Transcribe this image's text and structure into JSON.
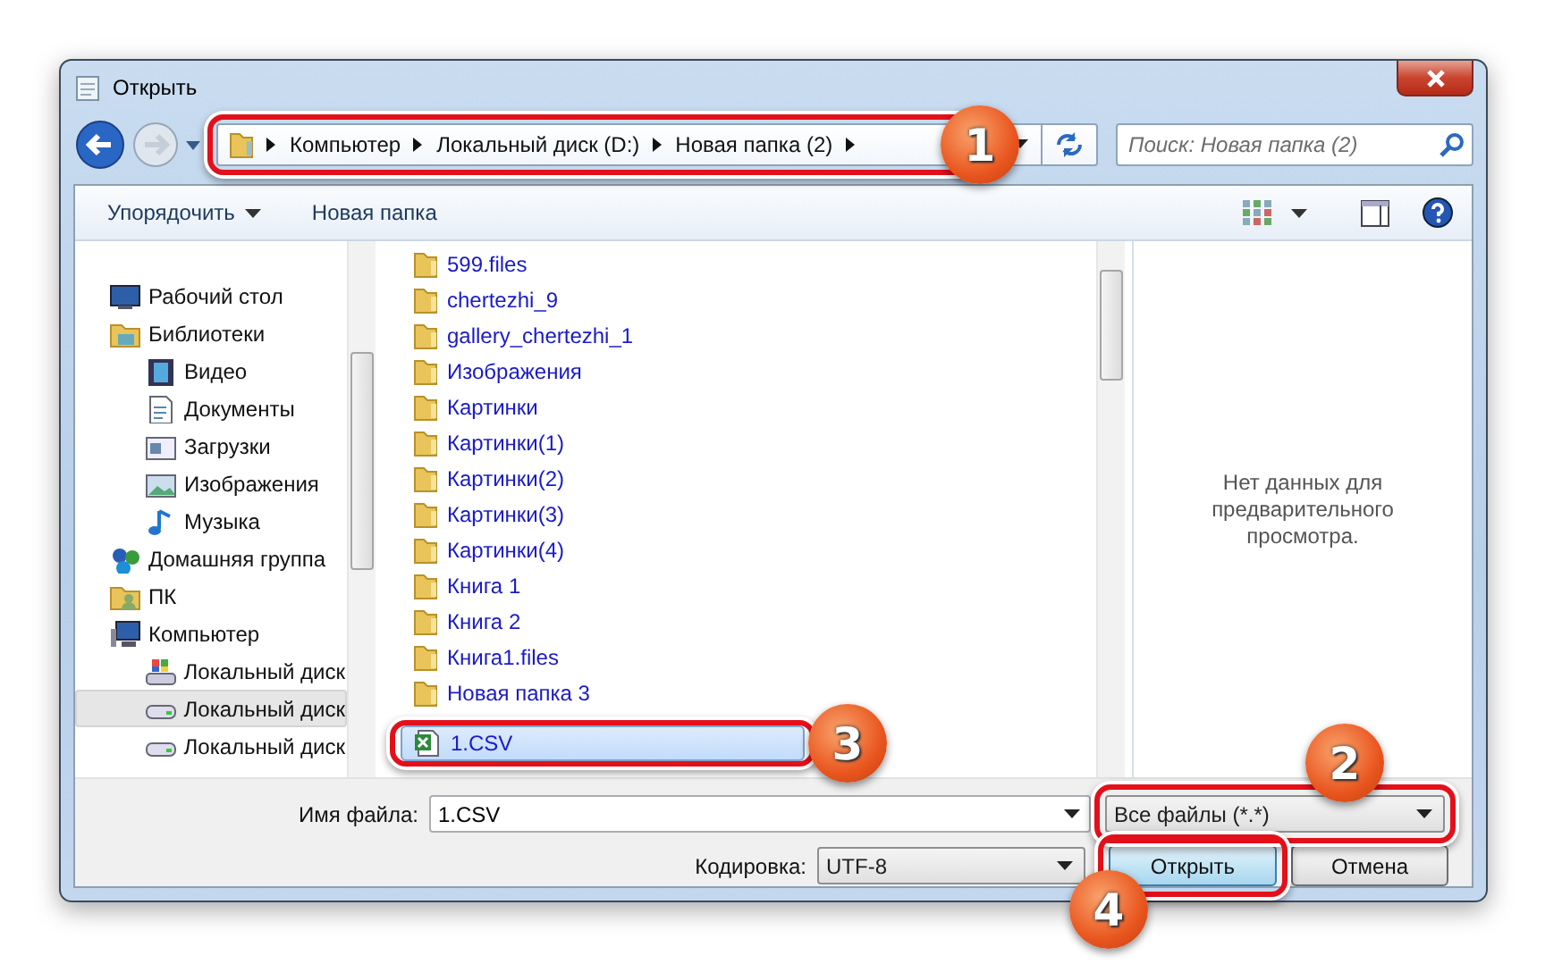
{
  "window": {
    "title": "Открыть"
  },
  "address_bar": {
    "path": [
      "Компьютер",
      "Локальный диск (D:)",
      "Новая папка (2)"
    ],
    "callout": "1"
  },
  "search": {
    "placeholder": "Поиск: Новая папка (2)"
  },
  "toolbar": {
    "organize": "Упорядочить",
    "new_folder": "Новая папка"
  },
  "sidebar": {
    "items": [
      {
        "label": "Рабочий стол",
        "kind": "desktop",
        "selected": false
      },
      {
        "label": "Библиотеки",
        "kind": "library",
        "selected": false,
        "children": [
          {
            "label": "Видео",
            "kind": "video",
            "selected": false
          },
          {
            "label": "Документы",
            "kind": "documents",
            "selected": false
          },
          {
            "label": "Загрузки",
            "kind": "downloads",
            "selected": false
          },
          {
            "label": "Изображения",
            "kind": "pictures",
            "selected": false
          },
          {
            "label": "Музыка",
            "kind": "music",
            "selected": false
          }
        ]
      },
      {
        "label": "Домашняя группа",
        "kind": "homegroup",
        "selected": false
      },
      {
        "label": "ПК",
        "kind": "user",
        "selected": false
      },
      {
        "label": "Компьютер",
        "kind": "computer",
        "selected": false,
        "children": [
          {
            "label": "Локальный диск",
            "kind": "system_drive",
            "selected": false
          },
          {
            "label": "Локальный диск",
            "kind": "drive",
            "selected": true
          },
          {
            "label": "Локальный диск",
            "kind": "drive",
            "selected": false
          }
        ]
      }
    ]
  },
  "files": [
    {
      "name": "599.files",
      "kind": "folder",
      "selected": false
    },
    {
      "name": "chertezhi_9",
      "kind": "folder",
      "selected": false
    },
    {
      "name": "gallery_chertezhi_1",
      "kind": "folder",
      "selected": false
    },
    {
      "name": "Изображения",
      "kind": "folder",
      "selected": false
    },
    {
      "name": "Картинки",
      "kind": "folder",
      "selected": false
    },
    {
      "name": "Картинки(1)",
      "kind": "folder",
      "selected": false
    },
    {
      "name": "Картинки(2)",
      "kind": "folder",
      "selected": false
    },
    {
      "name": "Картинки(3)",
      "kind": "folder",
      "selected": false
    },
    {
      "name": "Картинки(4)",
      "kind": "folder",
      "selected": false
    },
    {
      "name": "Книга 1",
      "kind": "folder",
      "selected": false
    },
    {
      "name": "Книга 2",
      "kind": "folder",
      "selected": false
    },
    {
      "name": "Книга1.files",
      "kind": "folder",
      "selected": false
    },
    {
      "name": "Новая папка 3",
      "kind": "folder",
      "selected": false
    },
    {
      "name": "1.CSV",
      "kind": "csv",
      "selected": true,
      "callout": "3"
    }
  ],
  "preview": {
    "message": "Нет данных для предварительного просмотра."
  },
  "file_name": {
    "label": "Имя файла:",
    "value": "1.CSV"
  },
  "file_type": {
    "value": "Все файлы  (*.*)",
    "callout": "2"
  },
  "encoding": {
    "label": "Кодировка:",
    "value": "UTF-8"
  },
  "buttons": [
    {
      "label": "Открыть",
      "kind": "default",
      "callout": "4"
    },
    {
      "label": "Отмена",
      "kind": "normal"
    }
  ]
}
